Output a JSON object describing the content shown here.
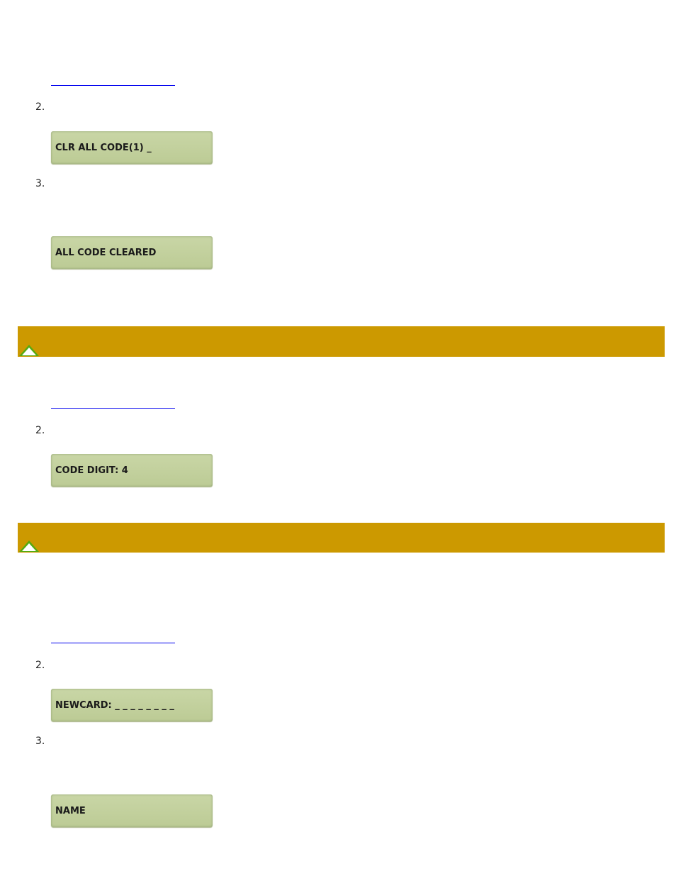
{
  "sections": [
    {
      "steps": [
        {
          "num": "2."
        },
        {
          "num": "3."
        }
      ],
      "displays": [
        "CLR ALL CODE(1) _",
        "ALL CODE CLEARED"
      ]
    },
    {
      "steps": [
        {
          "num": "2."
        }
      ],
      "displays": [
        "CODE DIGIT: 4"
      ]
    },
    {
      "steps": [
        {
          "num": "2."
        },
        {
          "num": "3."
        }
      ],
      "displays": [
        "NEWCARD: _ _ _ _ _ _ _ _",
        "NAME"
      ]
    }
  ],
  "colors": {
    "section_bar": "#cc9900",
    "lcd": "#c3d09e",
    "link": "#0000ee",
    "top_icon": "#55aa11"
  },
  "icons": {
    "back_to_top": "up-triangle-icon"
  }
}
